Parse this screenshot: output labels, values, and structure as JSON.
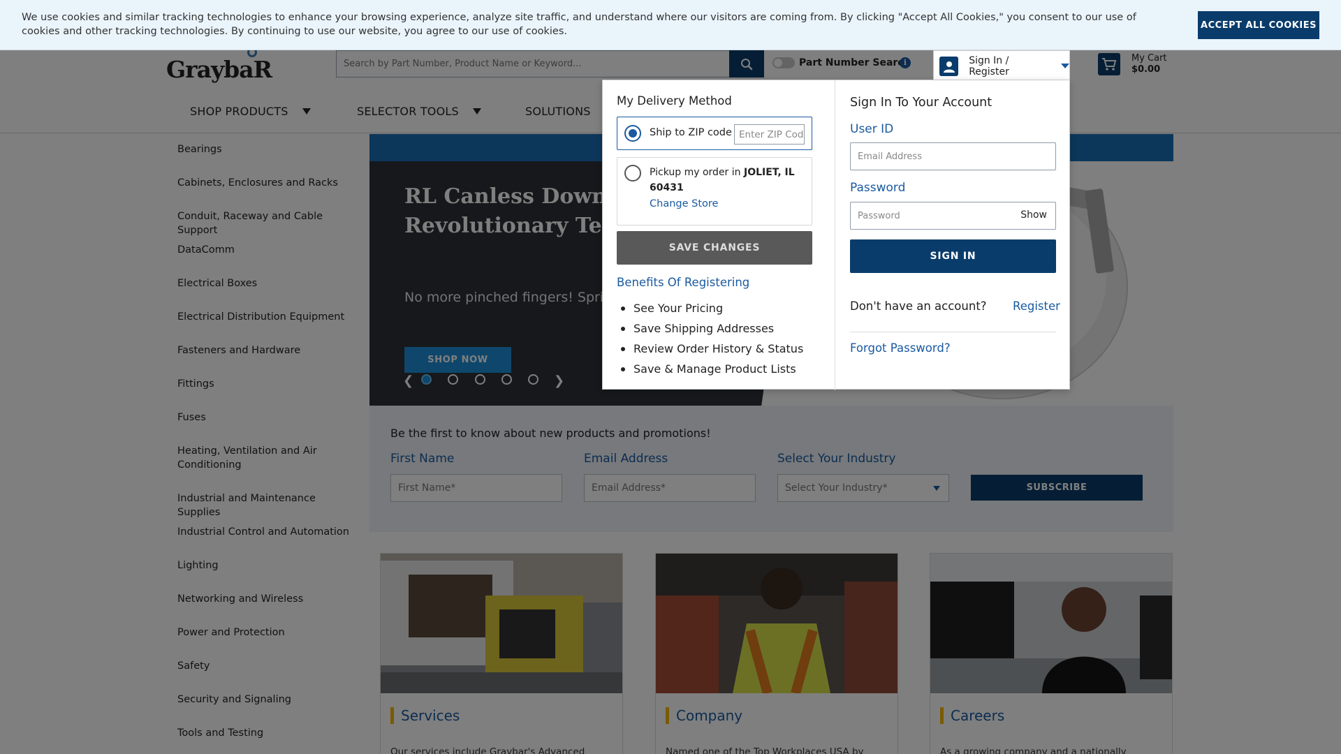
{
  "cookie_banner": {
    "text": "We use cookies and similar tracking technologies to enhance your browsing experience, analyze site traffic, and understand where our visitors are coming from. By clicking \"Accept All Cookies,\" you consent to our use of cookies and other tracking technologies. By continuing to use our website, you agree to our use of cookies.",
    "accept_label": "ACCEPT ALL COOKIES"
  },
  "header": {
    "logo_text": "GraybaR",
    "search_placeholder": "Search by Part Number, Product Name or Keyword...",
    "part_number_search_label": "Part Number Search",
    "signin_label": "Sign In / Register",
    "cart_label": "My Cart",
    "cart_total": "$0.00"
  },
  "nav": {
    "items": [
      {
        "label": "SHOP PRODUCTS"
      },
      {
        "label": "SELECTOR TOOLS"
      },
      {
        "label": "SOLUTIONS"
      }
    ]
  },
  "sidebar": {
    "categories": [
      "Bearings",
      "Cabinets, Enclosures and Racks",
      "Conduit, Raceway and Cable Support",
      "DataComm",
      "Electrical Boxes",
      "Electrical Distribution Equipment",
      "Fasteners and Hardware",
      "Fittings",
      "Fuses",
      "Heating, Ventilation and Air Conditioning",
      "Industrial and Maintenance Supplies",
      "Industrial Control and Automation",
      "Lighting",
      "Networking and Wireless",
      "Power and Protection",
      "Safety",
      "Security and Signaling",
      "Tools and Testing"
    ]
  },
  "hero": {
    "title": "RL Canless Downlig With Revolutionary Technology",
    "subtitle": "No more pinched fingers! Springs installation/removal.",
    "cta_label": "SHOP NOW",
    "prev_glyph": "❮",
    "next_glyph": "❯",
    "slide_count": 5,
    "active_slide": 1
  },
  "newsletter": {
    "title": "Be the first to know about new products and promotions!",
    "first_name_label": "First Name",
    "first_name_placeholder": "First Name*",
    "email_label": "Email Address",
    "email_placeholder": "Email Address*",
    "industry_label": "Select Your Industry",
    "industry_value": "Select Your Industry*",
    "subscribe_label": "SUBSCRIBE"
  },
  "cards": [
    {
      "title": "Services",
      "text": "Our services include Graybar's Advanced Supply"
    },
    {
      "title": "Company",
      "text": "Named one of the Top Workplaces USA by"
    },
    {
      "title": "Careers",
      "text": "As a growing company and a nationally"
    }
  ],
  "popover": {
    "delivery": {
      "title": "My Delivery Method",
      "ship_label": "Ship to ZIP code",
      "zip_placeholder": "Enter ZIP Code",
      "pickup_prefix": "Pickup my order in ",
      "pickup_store": "JOLIET, IL 60431",
      "change_store": "Change Store",
      "save_label": "SAVE CHANGES",
      "selected": "ship"
    },
    "benefits": {
      "title": "Benefits Of Registering",
      "items": [
        "See Your Pricing",
        "Save Shipping Addresses",
        "Review Order History & Status",
        "Save & Manage Product Lists"
      ]
    },
    "signin": {
      "title": "Sign In To Your Account",
      "userid_label": "User ID",
      "userid_placeholder": "Email Address",
      "password_label": "Password",
      "password_placeholder": "Password",
      "show_label": "Show",
      "signin_button": "SIGN IN",
      "no_account": "Don't have an account?",
      "register": "Register",
      "forgot": "Forgot Password?"
    }
  },
  "colors": {
    "brand_navy": "#0a3c6b",
    "link_blue": "#1a5aa0",
    "hero_blue": "#1e8ed9",
    "card_accent": "#f2b705"
  }
}
